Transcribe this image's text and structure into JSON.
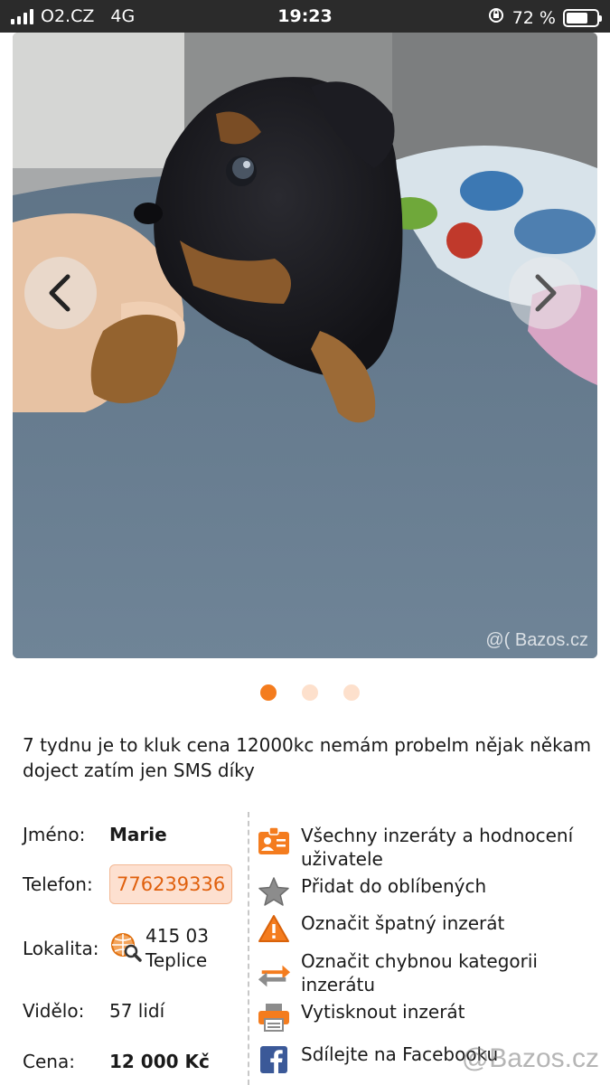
{
  "status_bar": {
    "carrier": "O2.CZ",
    "network": "4G",
    "time": "19:23",
    "battery_percent": "72 %",
    "battery_level": 0.72
  },
  "gallery": {
    "watermark": "@( Bazos.cz",
    "prev_icon": "chevron-left-icon",
    "next_icon": "chevron-right-icon",
    "total_images": 3,
    "active_index": 0
  },
  "listing": {
    "description": "7 tydnu je to kluk cena 12000kc nemám probelm nějak někam doject zatím jen SMS díky"
  },
  "details": {
    "name_label": "Jméno:",
    "name_value": "Marie",
    "phone_label": "Telefon:",
    "phone_value": "776239336",
    "location_label": "Lokalita:",
    "location_zip": "415 03",
    "location_city": "Teplice",
    "views_label": "Vidělo:",
    "views_value": "57 lidí",
    "price_label": "Cena:",
    "price_value": "12 000 Kč"
  },
  "actions": [
    {
      "label": "Všechny inzeráty a hodnocení uživatele",
      "icon": "user-card-icon"
    },
    {
      "label": "Přidat do oblíbených",
      "icon": "star-icon"
    },
    {
      "label": "Označit špatný inzerát",
      "icon": "warning-icon"
    },
    {
      "label": "Označit chybnou kategorii inzerátu",
      "icon": "swap-arrows-icon"
    },
    {
      "label": "Vytisknout inzerát",
      "icon": "printer-icon"
    },
    {
      "label": "Sdílejte na Facebooku",
      "icon": "facebook-icon"
    }
  ],
  "footer_watermark": "@Bazos.cz",
  "colors": {
    "accent": "#f47c1e",
    "phone_bg": "#fde0d0",
    "status_bar_bg": "#2b2b2b",
    "facebook": "#3b5998"
  }
}
